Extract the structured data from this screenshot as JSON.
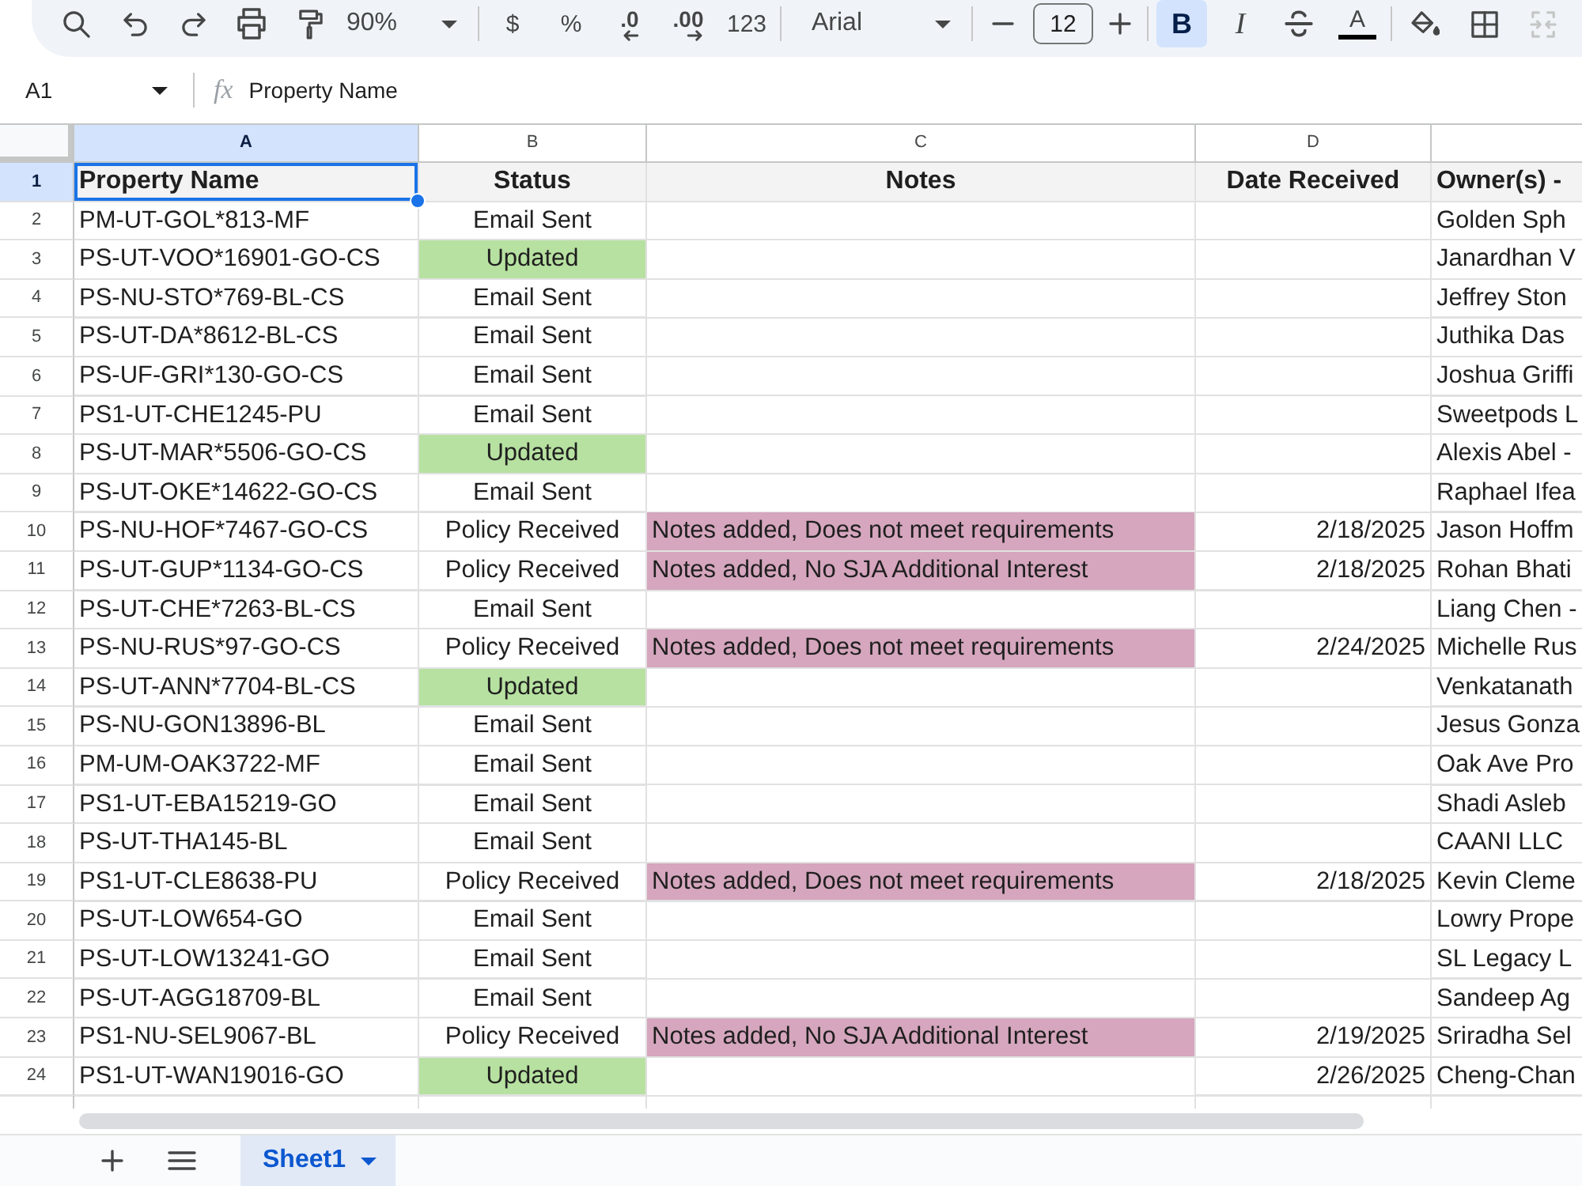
{
  "toolbar": {
    "zoom": "90%",
    "number_formats": [
      {
        "label": "$",
        "kind": "plain"
      },
      {
        "label": "%",
        "kind": "plain"
      },
      {
        "label": ".0",
        "kind": "decrease"
      },
      {
        "label": ".00",
        "kind": "increase"
      },
      {
        "label": "123",
        "kind": "plain"
      }
    ],
    "font": "Arial",
    "font_size": "12",
    "bold": {
      "label": "B",
      "selected": true
    },
    "italic": {
      "label": "I",
      "selected": false
    },
    "text_color": {
      "label": "A"
    },
    "merge": {
      "disabled": true
    }
  },
  "formula_bar": {
    "cell_ref": "A1",
    "function_label": "fx",
    "content": "Property Name"
  },
  "columns": [
    {
      "letter": "A",
      "selected": true
    },
    {
      "letter": "B",
      "selected": false
    },
    {
      "letter": "C",
      "selected": false
    },
    {
      "letter": "D",
      "selected": false
    },
    {
      "selected": false
    }
  ],
  "rows": [
    {
      "number": "1",
      "kind": "header",
      "selected": true,
      "cells": [
        {
          "text": "Property Name"
        },
        {
          "text": "Status"
        },
        {
          "text": "Notes"
        },
        {
          "text": "Date Received"
        },
        {
          "text": "Owner(s) -"
        }
      ]
    },
    {
      "number": "2",
      "kind": "data",
      "selected": false,
      "cells": [
        {
          "text": "PM-UT-GOL*813-MF"
        },
        {
          "text": "Email Sent"
        },
        null,
        null,
        {
          "text": "Golden Sph"
        }
      ]
    },
    {
      "number": "3",
      "kind": "data",
      "selected": false,
      "cells": [
        {
          "text": "PS-UT-VOO*16901-GO-CS"
        },
        {
          "text": "Updated",
          "color": "#b7e1a1"
        },
        null,
        null,
        {
          "text": "Janardhan V"
        }
      ]
    },
    {
      "number": "4",
      "kind": "data",
      "selected": false,
      "cells": [
        {
          "text": "PS-NU-STO*769-BL-CS"
        },
        {
          "text": "Email Sent"
        },
        null,
        null,
        {
          "text": "Jeffrey Ston"
        }
      ]
    },
    {
      "number": "5",
      "kind": "data",
      "selected": false,
      "cells": [
        {
          "text": "PS-UT-DA*8612-BL-CS"
        },
        {
          "text": "Email Sent"
        },
        null,
        null,
        {
          "text": "Juthika Das"
        }
      ]
    },
    {
      "number": "6",
      "kind": "data",
      "selected": false,
      "cells": [
        {
          "text": "PS-UF-GRI*130-GO-CS"
        },
        {
          "text": "Email Sent"
        },
        null,
        null,
        {
          "text": "Joshua Griffi"
        }
      ]
    },
    {
      "number": "7",
      "kind": "data",
      "selected": false,
      "cells": [
        {
          "text": "PS1-UT-CHE1245-PU"
        },
        {
          "text": "Email Sent"
        },
        null,
        null,
        {
          "text": "Sweetpods L"
        }
      ]
    },
    {
      "number": "8",
      "kind": "data",
      "selected": false,
      "cells": [
        {
          "text": "PS-UT-MAR*5506-GO-CS"
        },
        {
          "text": "Updated",
          "color": "#b7e1a1"
        },
        null,
        null,
        {
          "text": "Alexis Abel -"
        }
      ]
    },
    {
      "number": "9",
      "kind": "data",
      "selected": false,
      "cells": [
        {
          "text": "PS-UT-OKE*14622-GO-CS"
        },
        {
          "text": "Email Sent"
        },
        null,
        null,
        {
          "text": "Raphael Ifea"
        }
      ]
    },
    {
      "number": "10",
      "kind": "data",
      "selected": false,
      "cells": [
        {
          "text": "PS-NU-HOF*7467-GO-CS"
        },
        {
          "text": "Policy Received"
        },
        {
          "text": "Notes added, Does not meet requirements",
          "color": "#d5a6bd"
        },
        {
          "text": "2/18/2025"
        },
        {
          "text": "Jason Hoffm"
        }
      ]
    },
    {
      "number": "11",
      "kind": "data",
      "selected": false,
      "cells": [
        {
          "text": "PS-UT-GUP*1134-GO-CS"
        },
        {
          "text": "Policy Received"
        },
        {
          "text": "Notes added, No SJA Additional Interest",
          "color": "#d5a6bd"
        },
        {
          "text": "2/18/2025"
        },
        {
          "text": "Rohan Bhati"
        }
      ]
    },
    {
      "number": "12",
      "kind": "data",
      "selected": false,
      "cells": [
        {
          "text": "PS-UT-CHE*7263-BL-CS"
        },
        {
          "text": "Email Sent"
        },
        null,
        null,
        {
          "text": "Liang Chen -"
        }
      ]
    },
    {
      "number": "13",
      "kind": "data",
      "selected": false,
      "cells": [
        {
          "text": "PS-NU-RUS*97-GO-CS"
        },
        {
          "text": "Policy Received"
        },
        {
          "text": "Notes added, Does not meet requirements",
          "color": "#d5a6bd"
        },
        {
          "text": "2/24/2025"
        },
        {
          "text": "Michelle Rus"
        }
      ]
    },
    {
      "number": "14",
      "kind": "data",
      "selected": false,
      "cells": [
        {
          "text": "PS-UT-ANN*7704-BL-CS"
        },
        {
          "text": "Updated",
          "color": "#b7e1a1"
        },
        null,
        null,
        {
          "text": "Venkatanath"
        }
      ]
    },
    {
      "number": "15",
      "kind": "data",
      "selected": false,
      "cells": [
        {
          "text": "PS-NU-GON13896-BL"
        },
        {
          "text": "Email Sent"
        },
        null,
        null,
        {
          "text": "Jesus Gonza"
        }
      ]
    },
    {
      "number": "16",
      "kind": "data",
      "selected": false,
      "cells": [
        {
          "text": "PM-UM-OAK3722-MF"
        },
        {
          "text": "Email Sent"
        },
        null,
        null,
        {
          "text": "Oak Ave Pro"
        }
      ]
    },
    {
      "number": "17",
      "kind": "data",
      "selected": false,
      "cells": [
        {
          "text": "PS1-UT-EBA15219-GO"
        },
        {
          "text": "Email Sent"
        },
        null,
        null,
        {
          "text": "Shadi Asleb"
        }
      ]
    },
    {
      "number": "18",
      "kind": "data",
      "selected": false,
      "cells": [
        {
          "text": "PS-UT-THA145-BL"
        },
        {
          "text": "Email Sent"
        },
        null,
        null,
        {
          "text": "CAANI LLC"
        }
      ]
    },
    {
      "number": "19",
      "kind": "data",
      "selected": false,
      "cells": [
        {
          "text": "PS1-UT-CLE8638-PU"
        },
        {
          "text": "Policy Received"
        },
        {
          "text": "Notes added, Does not meet requirements",
          "color": "#d5a6bd"
        },
        {
          "text": "2/18/2025"
        },
        {
          "text": "Kevin Cleme"
        }
      ]
    },
    {
      "number": "20",
      "kind": "data",
      "selected": false,
      "cells": [
        {
          "text": "PS-UT-LOW654-GO"
        },
        {
          "text": "Email Sent"
        },
        null,
        null,
        {
          "text": "Lowry Prope"
        }
      ]
    },
    {
      "number": "21",
      "kind": "data",
      "selected": false,
      "cells": [
        {
          "text": "PS-UT-LOW13241-GO"
        },
        {
          "text": "Email Sent"
        },
        null,
        null,
        {
          "text": "SL Legacy L"
        }
      ]
    },
    {
      "number": "22",
      "kind": "data",
      "selected": false,
      "cells": [
        {
          "text": "PS-UT-AGG18709-BL"
        },
        {
          "text": "Email Sent"
        },
        null,
        null,
        {
          "text": "Sandeep Ag"
        }
      ]
    },
    {
      "number": "23",
      "kind": "data",
      "selected": false,
      "cells": [
        {
          "text": "PS1-NU-SEL9067-BL"
        },
        {
          "text": "Policy Received"
        },
        {
          "text": "Notes added, No SJA Additional Interest",
          "color": "#d5a6bd"
        },
        {
          "text": "2/19/2025"
        },
        {
          "text": "Sriradha Sel"
        }
      ]
    },
    {
      "number": "24",
      "kind": "data",
      "selected": false,
      "cells": [
        {
          "text": "PS1-UT-WAN19016-GO"
        },
        {
          "text": "Updated",
          "color": "#b7e1a1"
        },
        null,
        {
          "text": "2/26/2025"
        },
        {
          "text": "Cheng-Chan"
        }
      ]
    }
  ],
  "sheets": [
    {
      "name": "Sheet1",
      "selected": true
    }
  ]
}
